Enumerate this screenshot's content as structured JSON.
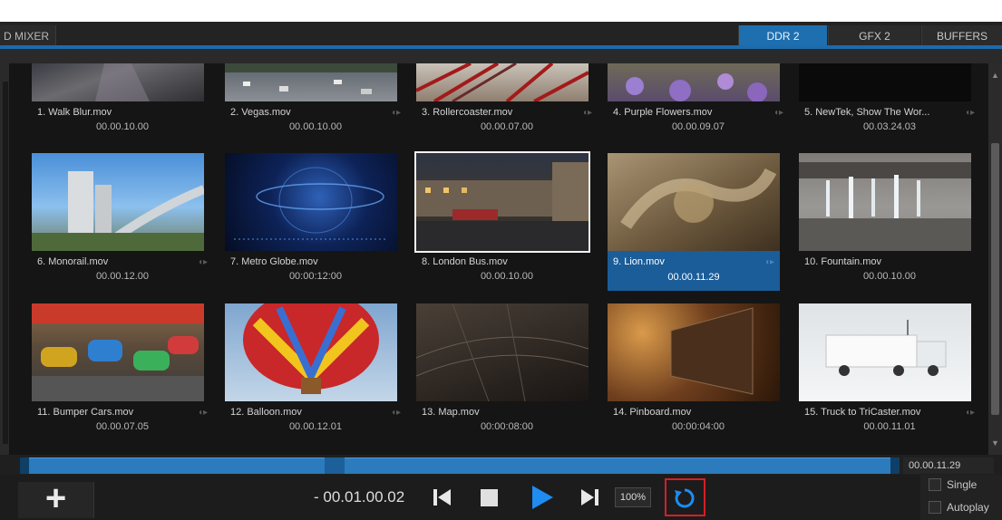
{
  "tabs": {
    "left_label": "D MIXER",
    "items": [
      {
        "label": "DDR 2",
        "active": true
      },
      {
        "label": "GFX 2",
        "active": false
      },
      {
        "label": "BUFFERS",
        "active": false
      }
    ]
  },
  "clips": [
    {
      "name": "1. Walk Blur.mov",
      "duration": "00.00.10.00",
      "audio": false
    },
    {
      "name": "2. Vegas.mov",
      "duration": "00.00.10.00",
      "audio": true
    },
    {
      "name": "3. Rollercoaster.mov",
      "duration": "00.00.07.00",
      "audio": true
    },
    {
      "name": "4. Purple Flowers.mov",
      "duration": "00.00.09.07",
      "audio": true
    },
    {
      "name": "5. NewTek, Show The Wor...",
      "duration": "00.03.24.03",
      "audio": true
    },
    {
      "name": "6. Monorail.mov",
      "duration": "00.00.12.00",
      "audio": true
    },
    {
      "name": "7. Metro Globe.mov",
      "duration": "00:00:12:00",
      "audio": false
    },
    {
      "name": "8. London Bus.mov",
      "duration": "00.00.10.00",
      "audio": false
    },
    {
      "name": "9. Lion.mov",
      "duration": "00.00.11.29",
      "audio": true,
      "selected": true
    },
    {
      "name": "10. Fountain.mov",
      "duration": "00.00.10.00",
      "audio": false
    },
    {
      "name": "11. Bumper Cars.mov",
      "duration": "00.00.07.05",
      "audio": true
    },
    {
      "name": "12. Balloon.mov",
      "duration": "00.00.12.01",
      "audio": true
    },
    {
      "name": "13. Map.mov",
      "duration": "00:00:08:00",
      "audio": false
    },
    {
      "name": "14. Pinboard.mov",
      "duration": "00:00:04:00",
      "audio": false
    },
    {
      "name": "15. Truck to TriCaster.mov",
      "duration": "00.00.11.01",
      "audio": true
    }
  ],
  "trackbar": {
    "clip_time": "00.00.11.29"
  },
  "transport": {
    "timecode": "- 00.01.00.02",
    "speed": "100%",
    "single_label": "Single",
    "autoplay_label": "Autoplay"
  },
  "colors": {
    "accent": "#1e6fb0",
    "selection": "#1a5d99",
    "highlight_box": "#d51f26"
  }
}
